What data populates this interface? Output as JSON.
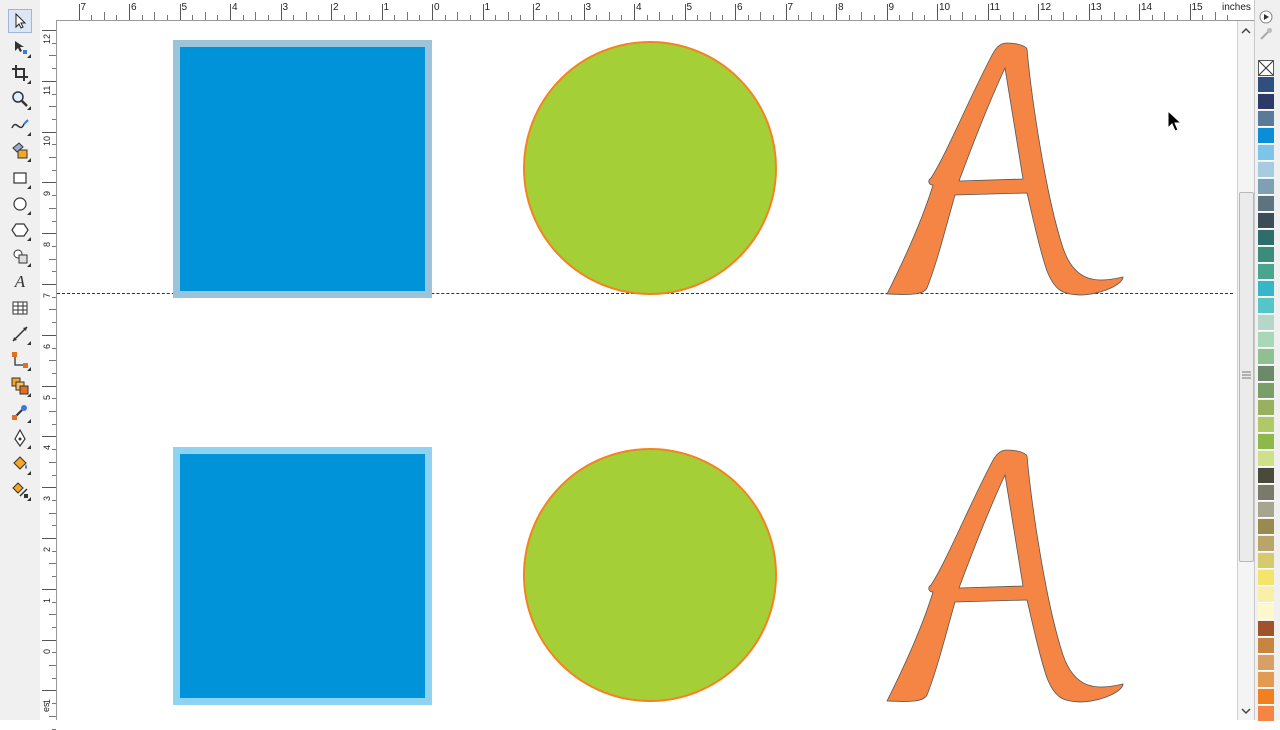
{
  "ruler": {
    "units_label": "inches",
    "h_labels": [
      "7",
      "6",
      "5",
      "4",
      "3",
      "2",
      "1",
      "0",
      "1",
      "2",
      "3",
      "4",
      "5",
      "6",
      "7",
      "8",
      "9",
      "10",
      "11",
      "12",
      "13",
      "14",
      "15"
    ],
    "v_labels": [
      "12",
      "11",
      "10",
      "9",
      "8",
      "7",
      "6",
      "5",
      "4",
      "3",
      "2",
      "1",
      "0",
      "1"
    ],
    "v_units_label": "es"
  },
  "tools": [
    {
      "name": "pick-tool",
      "icon": "arrow-icon"
    },
    {
      "name": "shape-tool",
      "icon": "node-icon"
    },
    {
      "name": "crop-tool",
      "icon": "crop-icon"
    },
    {
      "name": "zoom-tool",
      "icon": "magnifier-icon"
    },
    {
      "name": "freehand-tool",
      "icon": "curve-icon"
    },
    {
      "name": "smart-fill-tool",
      "icon": "smart-fill-icon"
    },
    {
      "name": "rectangle-tool",
      "icon": "rectangle-icon"
    },
    {
      "name": "ellipse-tool",
      "icon": "ellipse-icon"
    },
    {
      "name": "polygon-tool",
      "icon": "polygon-icon"
    },
    {
      "name": "basic-shapes-tool",
      "icon": "shapes-icon"
    },
    {
      "name": "text-tool",
      "icon": "text-a-icon"
    },
    {
      "name": "table-tool",
      "icon": "table-icon"
    },
    {
      "name": "dimension-tool",
      "icon": "dimension-icon"
    },
    {
      "name": "connector-tool",
      "icon": "connector-icon"
    },
    {
      "name": "blend-tool",
      "icon": "blend-icon"
    },
    {
      "name": "eyedropper-tool",
      "icon": "eyedropper-icon"
    },
    {
      "name": "outline-tool",
      "icon": "pen-nib-icon"
    },
    {
      "name": "fill-tool",
      "icon": "bucket-icon"
    },
    {
      "name": "interactive-fill-tool",
      "icon": "interactive-fill-icon"
    }
  ],
  "text_tool_glyph": "A",
  "colors": {
    "square_fill": "#0093d9",
    "square_outline_top": "#9bc3da",
    "square_outline_bottom": "#8fd3f2",
    "circle_fill": "#a5cf37",
    "circle_outline": "#f58220",
    "letter_fill": "#f58544",
    "letter_outline": "#555555"
  },
  "palette": [
    "none",
    "#2f4f7f",
    "#2b3a67",
    "#5b7a99",
    "#0a8fd6",
    "#7dc4e8",
    "#a7cbe0",
    "#7fa0b4",
    "#5d7480",
    "#3d4d57",
    "#2e6e6a",
    "#3b8c7a",
    "#4aa58f",
    "#36b6c8",
    "#56c5c9",
    "#b5d6c8",
    "#a8d8b8",
    "#8fc08f",
    "#6a8a6a",
    "#7a9e6a",
    "#98b060",
    "#b0c86a",
    "#8db84a",
    "#cfe08a",
    "#4a4a3a",
    "#7a7a6a",
    "#a6a690",
    "#9a8a50",
    "#b9a56b",
    "#d6c96e",
    "#f5e46a",
    "#f8f0a8",
    "#fff8cc",
    "#a0522d",
    "#c68642",
    "#d9a066",
    "#e39b53",
    "#f08020",
    "#f58544"
  ]
}
